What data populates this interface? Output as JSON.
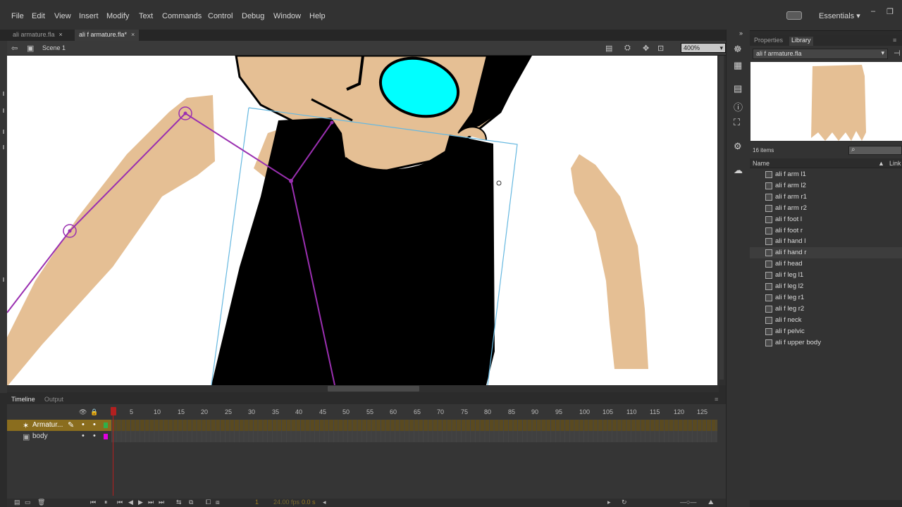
{
  "menu": [
    "File",
    "Edit",
    "View",
    "Insert",
    "Modify",
    "Text",
    "Commands",
    "Control",
    "Debug",
    "Window",
    "Help"
  ],
  "workspace": "Essentials",
  "window_controls": [
    "–",
    "❐"
  ],
  "doc_tabs": [
    {
      "label": "ali armature.fla",
      "active": false
    },
    {
      "label": "ali f armature.fla*",
      "active": true
    }
  ],
  "editbar": {
    "scene": "Scene 1",
    "zoom": "400%"
  },
  "timeline": {
    "tabs": [
      "Timeline",
      "Output"
    ],
    "frame_numbers": [
      "1",
      "5",
      "10",
      "15",
      "20",
      "25",
      "30",
      "35",
      "40",
      "45",
      "50",
      "55",
      "60",
      "65",
      "70",
      "75",
      "80",
      "85",
      "90",
      "95",
      "100",
      "105",
      "110",
      "115",
      "120",
      "125"
    ],
    "layers": [
      {
        "name": "Armatur...",
        "selected": true
      },
      {
        "name": "body",
        "selected": false
      }
    ],
    "bottom": {
      "current_frame": "1",
      "fps": "24.00 fps",
      "time": "0.0 s"
    }
  },
  "library": {
    "tabs": [
      "Properties",
      "Library"
    ],
    "document": "ali f armature.fla",
    "count": "16 items",
    "columns": [
      "Name",
      "Link"
    ],
    "items": [
      "ali f arm l1",
      "ali f arm l2",
      "ali f arm r1",
      "ali f arm r2",
      "ali f foot l",
      "ali f foot r",
      "ali f hand l",
      "ali f hand r",
      "ali f head",
      "ali f leg l1",
      "ali f leg l2",
      "ali f leg r1",
      "ali f leg r2",
      "ali f neck",
      "ali f pelvic",
      "ali f upper body"
    ],
    "selected_item": "ali f hand r"
  },
  "colors": {
    "skin": "#e5bf94",
    "bone": "#9a2fb0",
    "glasses": "#00ffff",
    "selection": "#66b8e0",
    "layer_sel": "#8a6d1e"
  }
}
